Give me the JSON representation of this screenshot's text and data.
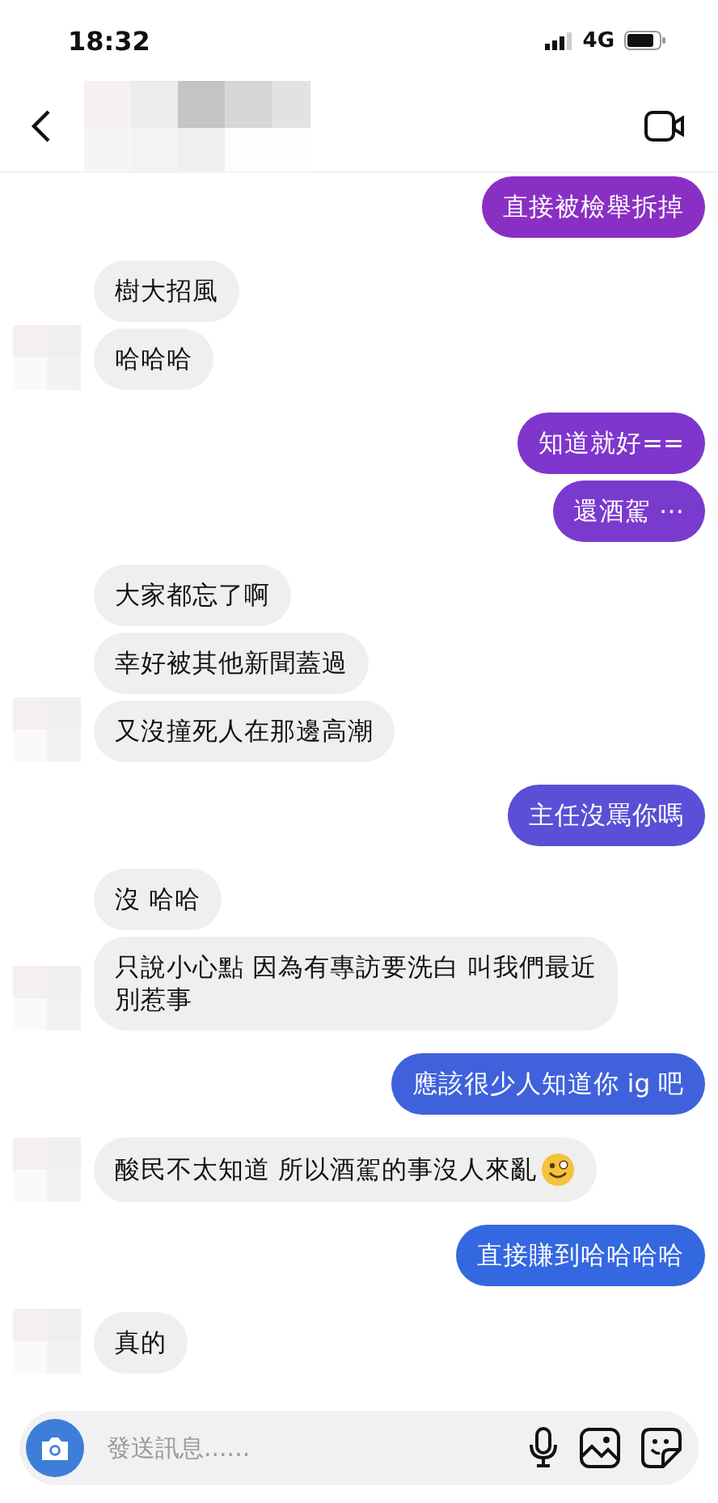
{
  "status_bar": {
    "time": "18:32",
    "network": "4G"
  },
  "header": {
    "kind": "blurred-contact"
  },
  "messages": [
    {
      "kind": "outgoing",
      "text": "直接被檢舉拆掉",
      "color": "#8a2fc4"
    },
    {
      "kind": "incoming",
      "text": "樹大招風"
    },
    {
      "kind": "incoming",
      "text": "哈哈哈"
    },
    {
      "kind": "outgoing",
      "text": "知道就好==",
      "color": "#7f36cc"
    },
    {
      "kind": "outgoing",
      "text": "還酒駕 ⋯",
      "color": "#7a3acd"
    },
    {
      "kind": "incoming",
      "text": "大家都忘了啊"
    },
    {
      "kind": "incoming",
      "text": "幸好被其他新聞蓋過"
    },
    {
      "kind": "incoming",
      "text": "又沒撞死人在那邊高潮"
    },
    {
      "kind": "outgoing",
      "text": "主任沒罵你嗎",
      "color": "#5a4fd6"
    },
    {
      "kind": "incoming",
      "text": "沒 哈哈"
    },
    {
      "kind": "incoming",
      "text": "只說小心點 因為有專訪要洗白 叫我們最近別惹事"
    },
    {
      "kind": "outgoing",
      "text": "應該很少人知道你 ig 吧",
      "color": "#3f62dc"
    },
    {
      "kind": "incoming",
      "text": "酸民不太知道 所以酒駕的事沒人來亂",
      "trailing_emoji": true
    },
    {
      "kind": "outgoing",
      "text": "直接賺到哈哈哈哈",
      "color": "#3468e0"
    },
    {
      "kind": "incoming",
      "text": "真的"
    }
  ],
  "composer": {
    "placeholder": "發送訊息......"
  }
}
